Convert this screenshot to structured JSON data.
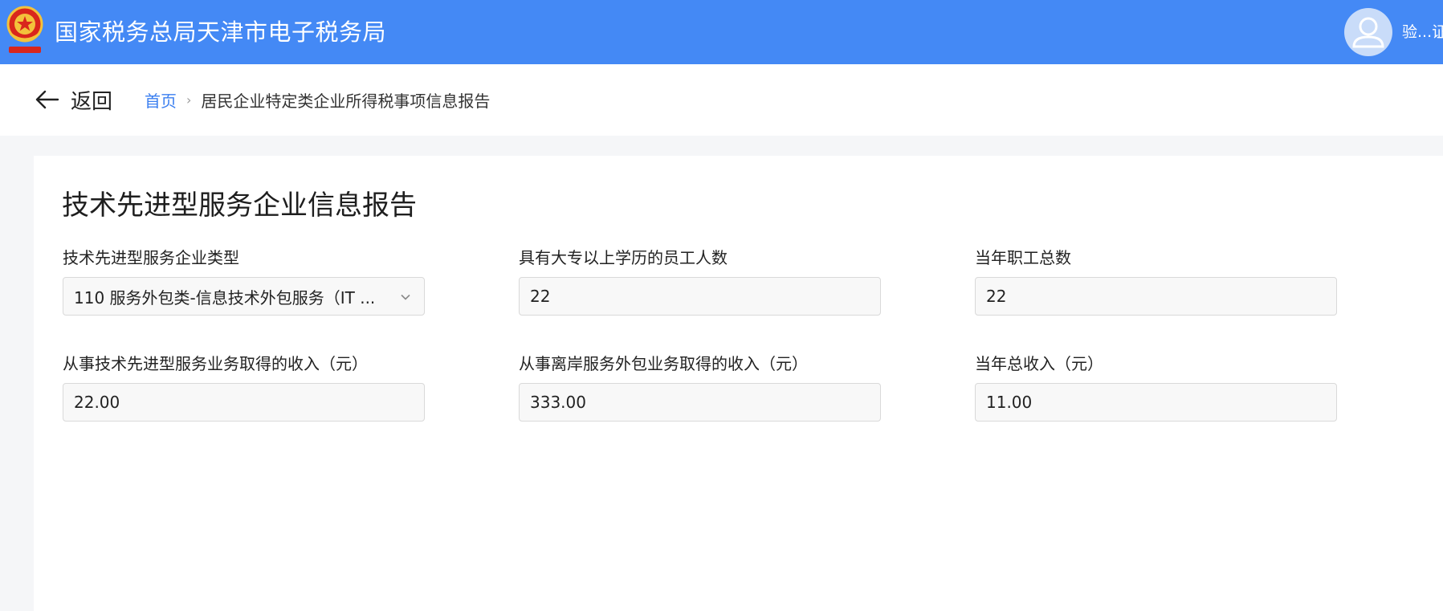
{
  "header": {
    "title": "国家税务总局天津市电子税务局",
    "user_name": "验...证"
  },
  "nav": {
    "back_label": "返回",
    "breadcrumb": {
      "home": "首页",
      "separator": "›",
      "current": "居民企业特定类企业所得税事项信息报告"
    }
  },
  "form": {
    "title": "技术先进型服务企业信息报告",
    "fields": [
      {
        "label": "技术先进型服务企业类型",
        "value": "110 服务外包类-信息技术外包服务（IT ...",
        "type": "select"
      },
      {
        "label": "具有大专以上学历的员工人数",
        "value": "22",
        "type": "input"
      },
      {
        "label": "当年职工总数",
        "value": "22",
        "type": "input"
      },
      {
        "label": "从事技术先进型服务业务取得的收入（元）",
        "value": "22.00",
        "type": "input"
      },
      {
        "label": "从事离岸服务外包业务取得的收入（元）",
        "value": "333.00",
        "type": "input"
      },
      {
        "label": "当年总收入（元）",
        "value": "11.00",
        "type": "input"
      }
    ]
  },
  "colors": {
    "header_bg": "#4489f5",
    "link": "#3b7ff0",
    "page_bg": "#f5f6f8"
  },
  "icons": [
    "tax-emblem-icon",
    "user-avatar-icon",
    "arrow-left-icon",
    "chevron-right-icon",
    "chevron-down-icon"
  ]
}
